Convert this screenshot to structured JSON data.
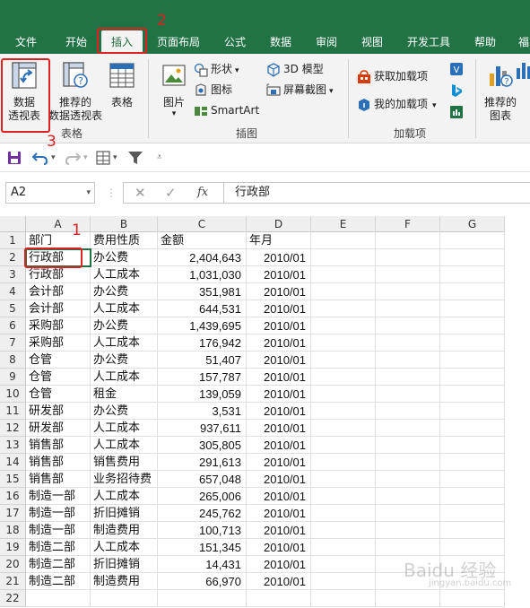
{
  "ribbon_tabs": [
    {
      "label": "文件",
      "active": false
    },
    {
      "label": "开始",
      "active": false
    },
    {
      "label": "插入",
      "active": true
    },
    {
      "label": "页面布局",
      "active": false
    },
    {
      "label": "公式",
      "active": false
    },
    {
      "label": "数据",
      "active": false
    },
    {
      "label": "审阅",
      "active": false
    },
    {
      "label": "视图",
      "active": false
    },
    {
      "label": "开发工具",
      "active": false
    },
    {
      "label": "帮助",
      "active": false
    },
    {
      "label": "福",
      "active": false
    }
  ],
  "ribbon": {
    "pivot_table_line1": "数据",
    "pivot_table_line2": "透视表",
    "recommended_pivot_line1": "推荐的",
    "recommended_pivot_line2": "数据透视表",
    "table": "表格",
    "group_tables": "表格",
    "pictures": "图片",
    "shapes": "形状",
    "icons": "图标",
    "smartart": "SmartArt",
    "models_3d": "3D 模型",
    "screenshot": "屏幕截图",
    "group_illustrations": "插图",
    "get_addins": "获取加载项",
    "my_addins": "我的加载项",
    "group_addins": "加载项",
    "recommended_charts_line1": "推荐的",
    "recommended_charts_line2": "图表"
  },
  "formula_bar": {
    "name_box": "A2",
    "formula_value": "行政部",
    "fx_label": "fx"
  },
  "sheet": {
    "columns": [
      "A",
      "B",
      "C",
      "D",
      "E",
      "F",
      "G"
    ],
    "header_row": [
      "部门",
      "费用性质",
      "金额",
      "年月"
    ],
    "rows": [
      [
        "行政部",
        "办公费",
        "2,404,643",
        "2010/01"
      ],
      [
        "行政部",
        "人工成本",
        "1,031,030",
        "2010/01"
      ],
      [
        "会计部",
        "办公费",
        "351,981",
        "2010/01"
      ],
      [
        "会计部",
        "人工成本",
        "644,531",
        "2010/01"
      ],
      [
        "采购部",
        "办公费",
        "1,439,695",
        "2010/01"
      ],
      [
        "采购部",
        "人工成本",
        "176,942",
        "2010/01"
      ],
      [
        "仓管",
        "办公费",
        "51,407",
        "2010/01"
      ],
      [
        "仓管",
        "人工成本",
        "157,787",
        "2010/01"
      ],
      [
        "仓管",
        "租金",
        "139,059",
        "2010/01"
      ],
      [
        "研发部",
        "办公费",
        "3,531",
        "2010/01"
      ],
      [
        "研发部",
        "人工成本",
        "937,611",
        "2010/01"
      ],
      [
        "销售部",
        "人工成本",
        "305,805",
        "2010/01"
      ],
      [
        "销售部",
        "销售费用",
        "291,613",
        "2010/01"
      ],
      [
        "销售部",
        "业务招待费",
        "657,048",
        "2010/01"
      ],
      [
        "制造一部",
        "人工成本",
        "265,006",
        "2010/01"
      ],
      [
        "制造一部",
        "折旧摊销",
        "245,762",
        "2010/01"
      ],
      [
        "制造一部",
        "制造费用",
        "100,713",
        "2010/01"
      ],
      [
        "制造二部",
        "人工成本",
        "151,345",
        "2010/01"
      ],
      [
        "制造二部",
        "折旧摊销",
        "14,431",
        "2010/01"
      ],
      [
        "制造二部",
        "制造费用",
        "66,970",
        "2010/01"
      ]
    ],
    "selected_cell": "A2"
  },
  "annotations": {
    "step1": "1",
    "step2": "2",
    "step3": "3",
    "color": "#e02020"
  },
  "watermark": {
    "text": "Baidu 经验",
    "subtext": "jingyan.baidu.com"
  },
  "colors": {
    "ribbon_green": "#217346",
    "ribbon_body": "#f3f3f3"
  }
}
